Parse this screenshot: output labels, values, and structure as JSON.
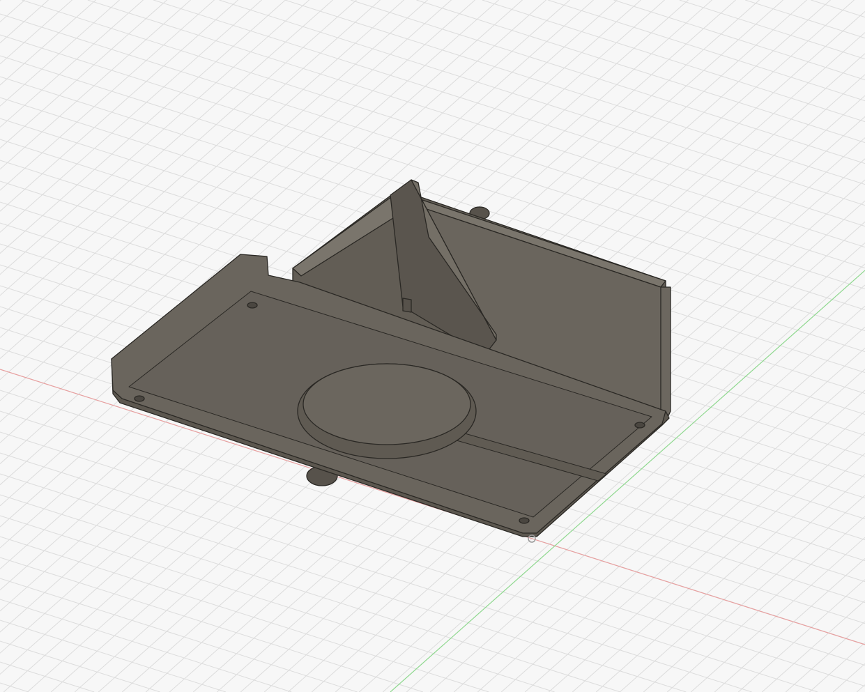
{
  "viewport": {
    "background": "#f7f7f7",
    "grid_color": "#dcdcdc",
    "x_axis_color": "#e8a0a0",
    "y_axis_color": "#8fd88f",
    "model_color": "#6a655d",
    "model_dark": "#57524b",
    "model_light": "#7a756c",
    "edge_color": "#2a2824"
  }
}
